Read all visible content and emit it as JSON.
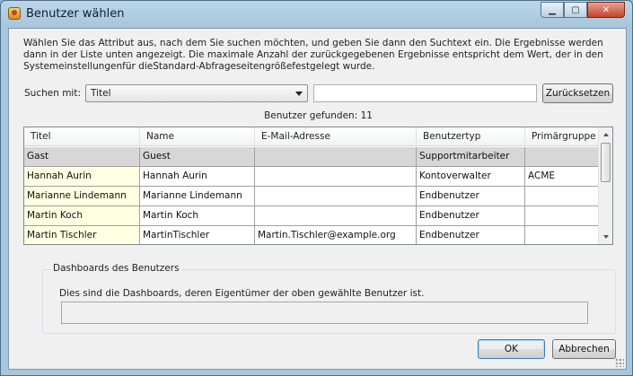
{
  "window": {
    "title": "Benutzer wählen"
  },
  "description": "Wählen Sie das Attribut aus, nach dem Sie suchen möchten, und geben Sie dann den Suchtext ein. Die Ergebnisse werden dann in der Liste unten angezeigt. Die maximale Anzahl der zurückgegebenen Ergebnisse entspricht dem Wert, der in den Systemeinstellungenfür dieStandard-Abfrageseitengrößefestgelegt wurde.",
  "search": {
    "label": "Suchen mit:",
    "attribute_selected": "Titel",
    "text_value": "",
    "reset_label": "Zurücksetzen"
  },
  "results": {
    "found_text": "Benutzer gefunden: 11"
  },
  "table": {
    "columns": [
      "Titel",
      "Name",
      "E-Mail-Adresse",
      "Benutzertyp",
      "Primärgruppe"
    ],
    "rows": [
      [
        "Gast",
        "Guest",
        "",
        "Supportmitarbeiter",
        ""
      ],
      [
        "Hannah Aurin",
        "Hannah Aurin",
        "",
        "Kontoverwalter",
        "ACME"
      ],
      [
        "Marianne Lindemann",
        "Marianne Lindemann",
        "",
        "Endbenutzer",
        ""
      ],
      [
        "Martin Koch",
        "Martin Koch",
        "",
        "Endbenutzer",
        ""
      ],
      [
        "Martin Tischler",
        "MartinTischler",
        "Martin.Tischler@example.org",
        "Endbenutzer",
        ""
      ]
    ]
  },
  "dashboards": {
    "group_label": "Dashboards des Benutzers",
    "description": "Dies sind die Dashboards, deren Eigentümer der oben gewählte Benutzer ist."
  },
  "footer": {
    "ok_label": "OK",
    "cancel_label": "Abbrechen"
  },
  "icons": {
    "app": "users-app-icon",
    "minimize": "minimize-icon",
    "maximize": "maximize-icon",
    "close": "close-icon",
    "dropdown": "chevron-down-icon"
  },
  "colors": {
    "first_column_bg": "#ffffe1",
    "selected_row_bg": "#d7d7d7",
    "titlebar": "#a8c6dc",
    "close_button": "#c4432a"
  }
}
